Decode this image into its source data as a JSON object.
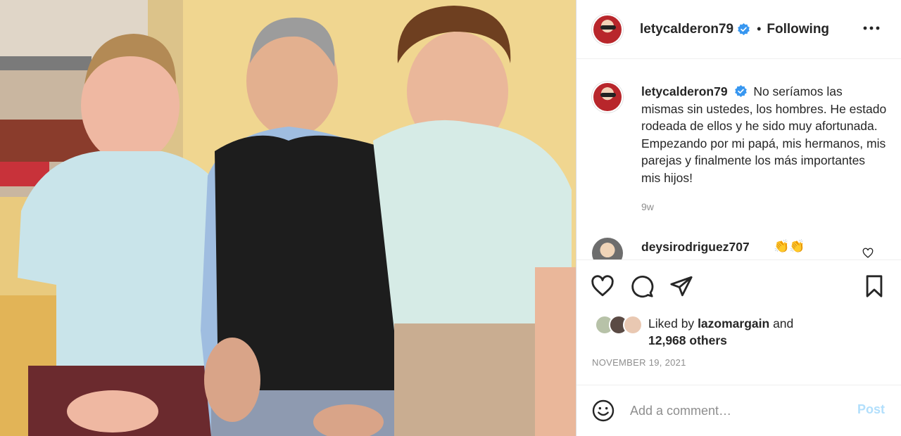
{
  "post": {
    "username": "letycalderon79",
    "verified": true,
    "follow_status": "Following",
    "more_icon": "more-horizontal-icon"
  },
  "caption": {
    "username": "letycalderon79",
    "text": "No seríamos las mismas sin ustedes, los hombres. He estado rodeada de ellos y he sido muy afortunada. Empezando por mi papá, mis hermanos, mis parejas y finalmente los más importantes mis hijos!",
    "time": "9w"
  },
  "comments": [
    {
      "username": "deysirodriguez707",
      "text": "👏👏"
    }
  ],
  "actions": {
    "like": "heart-icon",
    "comment": "comment-icon",
    "share": "send-icon",
    "save": "bookmark-icon"
  },
  "likes": {
    "prefix": "Liked by",
    "user": "lazomargain",
    "conjunction": "and",
    "others": "12,968 others"
  },
  "date": "NOVEMBER 19, 2021",
  "comment_box": {
    "placeholder": "Add a comment…",
    "post_label": "Post",
    "emoji_icon": "emoji-icon"
  },
  "colors": {
    "verified_blue": "#3897f0",
    "post_disabled": "#b2dffc",
    "muted_text": "#8e8e8e",
    "wall_yellow": "#e8c978"
  }
}
